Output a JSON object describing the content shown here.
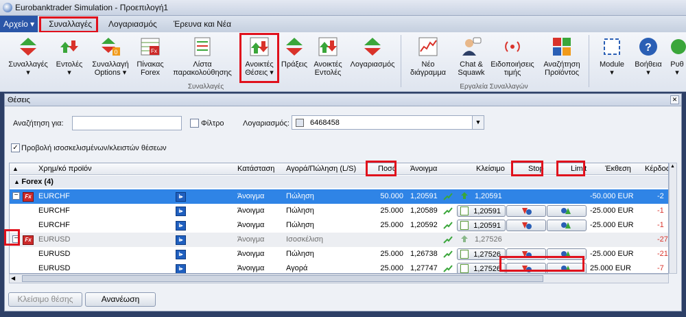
{
  "window": {
    "title": "Eurobanktrader Simulation - Προεπιλογή1"
  },
  "menu": {
    "file": "Αρχείο",
    "items": [
      "Συναλλαγές",
      "Λογαριασμός",
      "Έρευνα και Νέα"
    ]
  },
  "ribbon": {
    "buttons": [
      {
        "l1": "Συναλλαγές",
        "l2": "▾"
      },
      {
        "l1": "Εντολές",
        "l2": "▾"
      },
      {
        "l1": "Συναλλαγή",
        "l2": "Options ▾"
      },
      {
        "l1": "Πίνακας",
        "l2": "Forex"
      },
      {
        "l1": "Λίστα",
        "l2": "παρακολούθησης"
      },
      {
        "l1": "Ανοικτές",
        "l2": "Θέσεις ▾"
      },
      {
        "l1": "Πράξεις",
        "l2": ""
      },
      {
        "l1": "Ανοικτές",
        "l2": "Εντολές"
      },
      {
        "l1": "Λογαριασμός",
        "l2": ""
      },
      {
        "l1": "Νέο",
        "l2": "διάγραμμα"
      },
      {
        "l1": "Chat &",
        "l2": "Squawk"
      },
      {
        "l1": "Ειδοποιήσεις",
        "l2": "τιμής"
      },
      {
        "l1": "Αναζήτηση",
        "l2": "Προϊόντος"
      },
      {
        "l1": "Module",
        "l2": "▾"
      },
      {
        "l1": "Βοήθεια",
        "l2": "▾"
      },
      {
        "l1": "Ρυθ",
        "l2": "▾"
      }
    ],
    "group1": "Συναλλαγές",
    "group2": "Εργαλεία Συναλλαγών"
  },
  "panel": {
    "title": "Θέσεις",
    "search_label": "Αναζήτηση για:",
    "search_value": "",
    "filter_label": "Φίλτρο",
    "filter_checked": false,
    "account_label": "Λογαριασμός:",
    "account_value": "6468458",
    "show_closed_label": "Προβολή ισοσκελισμένων/κλειστών θέσεων",
    "show_closed_checked": true,
    "columns": {
      "instrument": "Χρημ/κό προϊόν",
      "status": "Κατάσταση",
      "side": "Αγορά/Πώληση (L/S)",
      "amount": "Ποσό",
      "open": "Άνοιγμα",
      "close": "Κλείσιμο",
      "stop": "Stop",
      "limit": "Limit",
      "exposure": "Έκθεση",
      "profit": "Κέρδος"
    },
    "group_label": "Forex (4)",
    "rows": [
      {
        "name": "EURCHF",
        "status": "Άνοιγμα",
        "side": "Πώληση",
        "amount": "50.000",
        "open": "1,20591",
        "close": "1,20591",
        "exposure": "-50.000 EUR",
        "profit": "-2"
      },
      {
        "name": "EURCHF",
        "status": "Άνοιγμα",
        "side": "Πώληση",
        "amount": "25.000",
        "open": "1,20589",
        "close": "1,20591",
        "exposure": "-25.000 EUR",
        "profit": "-1"
      },
      {
        "name": "EURCHF",
        "status": "Άνοιγμα",
        "side": "Πώληση",
        "amount": "25.000",
        "open": "1,20592",
        "close": "1,20591",
        "exposure": "-25.000 EUR",
        "profit": "-1"
      },
      {
        "name": "EURUSD",
        "status": "Άνοιγμα",
        "side": "Ισοσκέλιση",
        "amount": "",
        "open": "",
        "close": "1,27526",
        "exposure": "",
        "profit": "-27"
      },
      {
        "name": "EURUSD",
        "status": "Άνοιγμα",
        "side": "Πώληση",
        "amount": "25.000",
        "open": "1,26738",
        "close": "1,27526",
        "exposure": "-25.000 EUR",
        "profit": "-21"
      },
      {
        "name": "EURUSD",
        "status": "Άνοιγμα",
        "side": "Αγορά",
        "amount": "25.000",
        "open": "1,27747",
        "close": "1,27526",
        "exposure": "25.000 EUR",
        "profit": "-7"
      }
    ],
    "close_position_btn": "Κλείσιμο θέσης",
    "refresh_btn": "Ανανέωση",
    "fx_badge": "Fx",
    "i_badge": "i▸"
  }
}
